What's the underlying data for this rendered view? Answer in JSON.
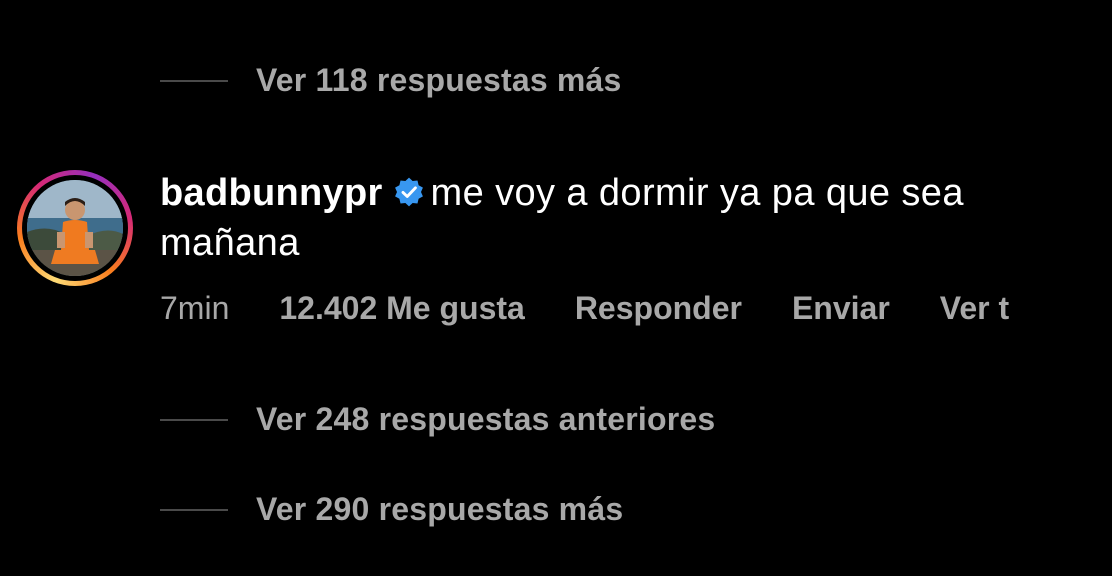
{
  "replies_top": {
    "label": "Ver 118 respuestas más"
  },
  "comment": {
    "username": "badbunnypr",
    "verified_icon": "verified-badge-icon",
    "text": "me voy a dormir ya pa que sea mañana",
    "time": "7min",
    "likes": "12.402 Me gusta",
    "reply_label": "Responder",
    "send_label": "Enviar",
    "translate_label": "Ver t"
  },
  "replies_previous": {
    "label": "Ver 248 respuestas anteriores"
  },
  "replies_more": {
    "label": "Ver 290 respuestas más"
  },
  "colors": {
    "background": "#000000",
    "primary_text": "#ffffff",
    "secondary_text": "#a8a8a8",
    "verified_blue": "#3897f0"
  }
}
